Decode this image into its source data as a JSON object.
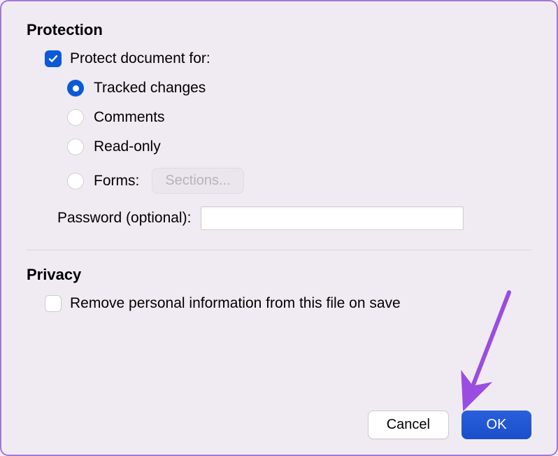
{
  "protection": {
    "heading": "Protection",
    "protect_label": "Protect document for:",
    "protect_checked": true,
    "options": {
      "tracked_changes": "Tracked changes",
      "comments": "Comments",
      "read_only": "Read-only",
      "forms": "Forms:"
    },
    "selected_option": "tracked_changes",
    "sections_button": "Sections...",
    "password_label": "Password (optional):",
    "password_value": ""
  },
  "privacy": {
    "heading": "Privacy",
    "remove_info_label": "Remove personal information from this file on save",
    "remove_info_checked": false
  },
  "buttons": {
    "cancel": "Cancel",
    "ok": "OK"
  },
  "colors": {
    "accent": "#0a5ad6",
    "arrow": "#9a4de0"
  }
}
